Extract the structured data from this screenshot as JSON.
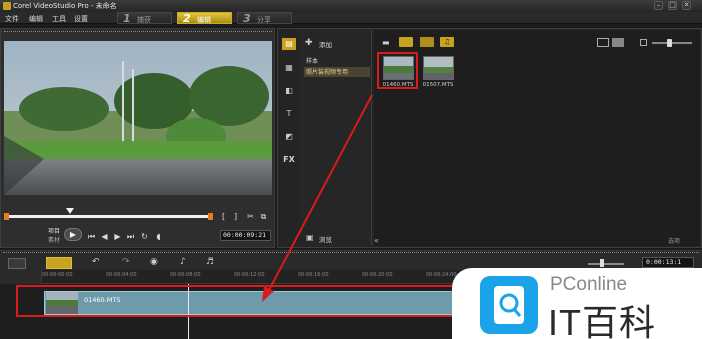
{
  "window": {
    "title": "Corel VideoStudio Pro - 未命名",
    "min": "–",
    "max": "□",
    "close": "✕"
  },
  "menu": [
    "文件",
    "编辑",
    "工具",
    "设置"
  ],
  "steps": [
    {
      "num": "1",
      "label": "捕获"
    },
    {
      "num": "2",
      "label": "编辑"
    },
    {
      "num": "3",
      "label": "分享"
    }
  ],
  "preview": {
    "mode_project": "项目",
    "mode_clip": "素材",
    "timecode": "00:00:09:21",
    "bracket_in": "[",
    "bracket_out": "]"
  },
  "library": {
    "add_label": "添加",
    "folders": [
      "样本",
      "照片装视频专用"
    ],
    "browse_label": "浏览",
    "collapse_label": "«",
    "options_label": "选项",
    "clips": [
      {
        "name": "01460.MTS",
        "selected": true
      },
      {
        "name": "01507.MTS",
        "selected": false
      }
    ]
  },
  "timeline": {
    "timecode": "0:00:13:1",
    "ruler_labels": [
      "00:00:00:00",
      "00:00:04:00",
      "00:00:08:00",
      "00:00:12:00",
      "00:00:16:00",
      "00:00:20:00",
      "00:00:24:00",
      "00:00:28:00"
    ],
    "clip_name": "01460.MTS"
  },
  "watermark": {
    "brand": "PConline",
    "slogan": "IT百科"
  },
  "colors": {
    "accent": "#e2c02a",
    "annotation": "#d81b1b",
    "clip": "#6e9bac"
  }
}
